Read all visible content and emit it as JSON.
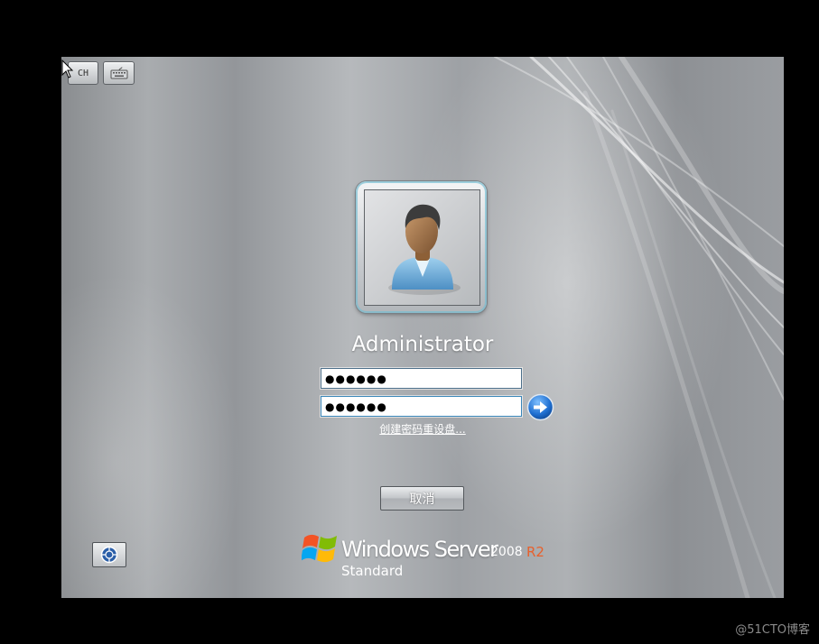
{
  "toolbar": {
    "language_label": "CH",
    "keyboard_icon": "keyboard-icon"
  },
  "user": {
    "name": "Administrator",
    "avatar_icon": "user-avatar-icon"
  },
  "login": {
    "password_value": "●●●●●●",
    "confirm_value": "●●●●●●",
    "submit_icon": "arrow-right-icon",
    "reset_link": "创建密码重设盘..."
  },
  "actions": {
    "cancel_label": "取消",
    "ease_of_access_icon": "ease-of-access-icon"
  },
  "branding": {
    "logo_icon": "windows-flag-icon",
    "product": "Windows Server",
    "version": "2008",
    "release": "R2",
    "edition": "Standard"
  },
  "watermark": "@51CTO博客",
  "colors": {
    "accent_release": "#e8602c",
    "go_button": "#1f6fd1"
  }
}
